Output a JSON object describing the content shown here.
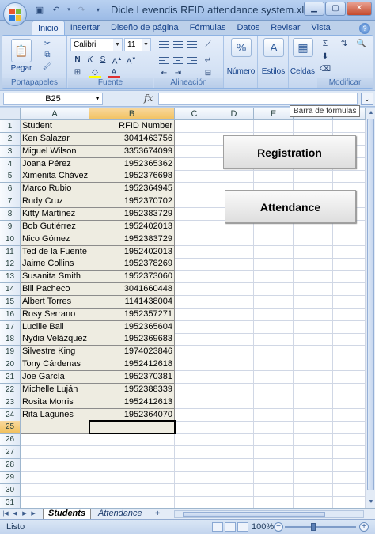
{
  "window": {
    "title": "Dicle Levendis RFID attendance system.xlsm"
  },
  "ribbon": {
    "tabs": [
      "Inicio",
      "Insertar",
      "Diseño de página",
      "Fórmulas",
      "Datos",
      "Revisar",
      "Vista"
    ],
    "active_tab": "Inicio",
    "groups": {
      "clipboard": {
        "label": "Portapapeles",
        "paste_label": "Pegar"
      },
      "font": {
        "label": "Fuente",
        "font_name": "Calibri",
        "font_size": "11"
      },
      "alignment": {
        "label": "Alineación"
      },
      "number": {
        "label": "Número"
      },
      "styles": {
        "label": "Estilos"
      },
      "cells": {
        "label": "Celdas"
      },
      "editing": {
        "label": "Modificar"
      }
    }
  },
  "formula_bar": {
    "name_box": "B25",
    "fx": "fx",
    "tooltip": "Barra de fórmulas"
  },
  "grid": {
    "columns": [
      "A",
      "B",
      "C",
      "D",
      "E",
      "F",
      "G"
    ],
    "rows": [
      "1",
      "2",
      "3",
      "4",
      "5",
      "6",
      "7",
      "8",
      "9",
      "10",
      "11",
      "12",
      "13",
      "14",
      "15",
      "16",
      "17",
      "18",
      "19",
      "20",
      "21",
      "22",
      "23",
      "24",
      "25",
      "26",
      "27",
      "28",
      "29",
      "30",
      "31"
    ],
    "header": {
      "student": "Student",
      "rfid": "RFID Number"
    },
    "records": [
      {
        "student": "Ken Salazar",
        "rfid": "3041463756"
      },
      {
        "student": "Miguel Wilson",
        "rfid": "3353674099"
      },
      {
        "student": "Joana Pérez",
        "rfid": "1952365362"
      },
      {
        "student": "Ximenita Chávez",
        "rfid": "1952376698"
      },
      {
        "student": "Marco Rubio",
        "rfid": "1952364945"
      },
      {
        "student": "Rudy Cruz",
        "rfid": "1952370702"
      },
      {
        "student": "Kitty Martínez",
        "rfid": "1952383729"
      },
      {
        "student": "Bob Gutiérrez",
        "rfid": "1952402013"
      },
      {
        "student": "Nico Gómez",
        "rfid": "1952383729"
      },
      {
        "student": "Ted de la Fuente",
        "rfid": "1952402013"
      },
      {
        "student": "Jaime Collins",
        "rfid": "1952378269"
      },
      {
        "student": "Susanita Smith",
        "rfid": "1952373060"
      },
      {
        "student": "Bill Pacheco",
        "rfid": "3041660448"
      },
      {
        "student": "Albert Torres",
        "rfid": "1141438004"
      },
      {
        "student": "Rosy Serrano",
        "rfid": "1952357271"
      },
      {
        "student": "Lucille Ball",
        "rfid": "1952365604"
      },
      {
        "student": "Nydia Velázquez",
        "rfid": "1952369683"
      },
      {
        "student": "Silvestre King",
        "rfid": "1974023846"
      },
      {
        "student": "Tony Cárdenas",
        "rfid": "1952412618"
      },
      {
        "student": "Joe García",
        "rfid": "1952370381"
      },
      {
        "student": "Michelle Luján",
        "rfid": "1952388339"
      },
      {
        "student": "Rosita Morris",
        "rfid": "1952412613"
      },
      {
        "student": "Rita Lagunes",
        "rfid": "1952364070"
      }
    ],
    "selected_cell": "B25"
  },
  "buttons": {
    "registration": "Registration",
    "attendance": "Attendance"
  },
  "sheets": {
    "tabs": [
      "Students",
      "Attendance"
    ],
    "active": "Students"
  },
  "status": {
    "text": "Listo",
    "zoom": "100%"
  }
}
